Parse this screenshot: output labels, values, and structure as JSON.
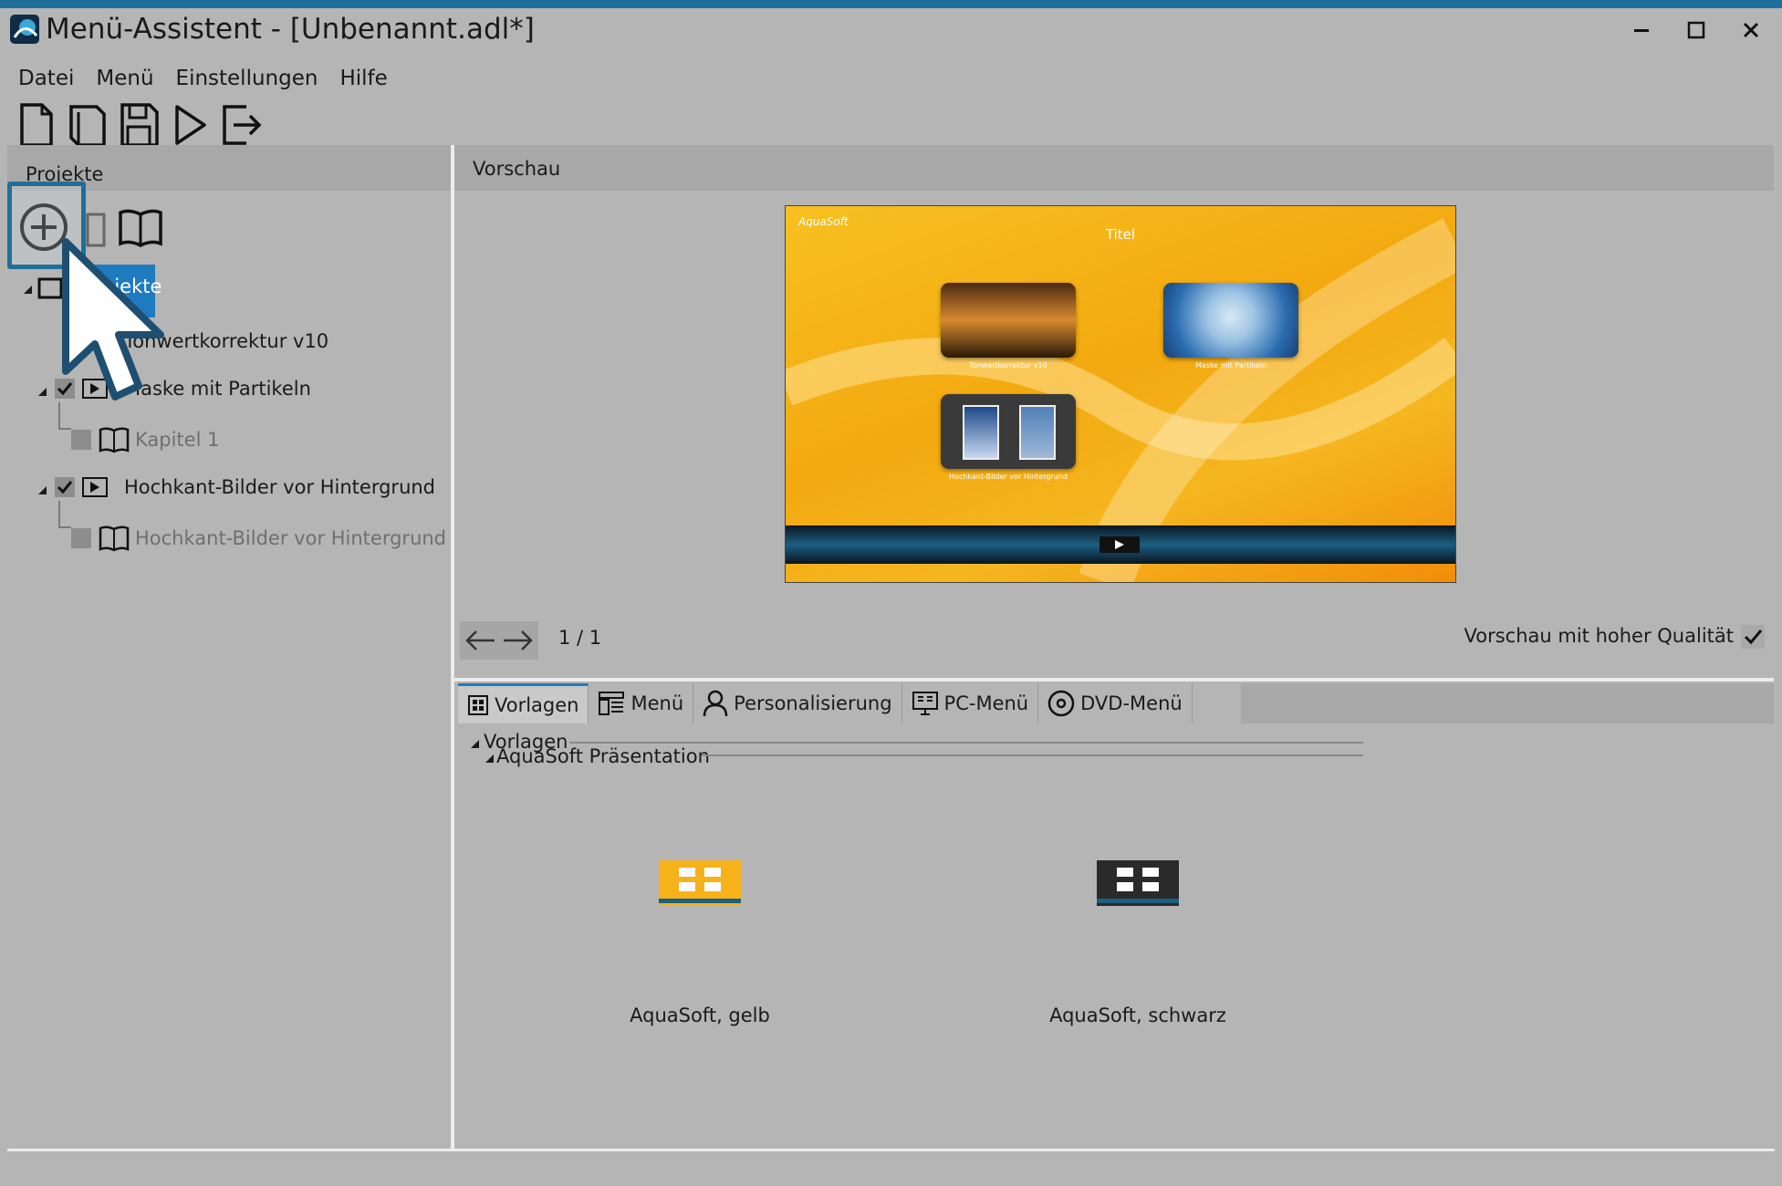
{
  "window": {
    "title": "Menü-Assistent - [Unbenannt.adl*]",
    "controls": {
      "minimize": "—",
      "maximize": "☐",
      "close": "✕"
    }
  },
  "menubar": [
    "Datei",
    "Menü",
    "Einstellungen",
    "Hilfe"
  ],
  "toolbar": [
    "new-file-icon",
    "open-icon",
    "save-icon",
    "play-icon",
    "exit-icon"
  ],
  "left_panel": {
    "header": "Projekte",
    "tools": [
      "add-circle-icon",
      "delete-icon",
      "book-icon"
    ],
    "root_label": "Projekte",
    "tree": [
      {
        "label": "Tonwertkorrektur v10",
        "checked": true,
        "dimmed": false
      },
      {
        "label": "Maske mit Partikeln",
        "checked": true,
        "dimmed": false
      },
      {
        "label": "Kapitel 1",
        "checked": false,
        "dimmed": true
      },
      {
        "label": "Hochkant-Bilder vor Hintergrund",
        "checked": true,
        "dimmed": false
      },
      {
        "label": "Hochkant-Bilder vor Hintergrund",
        "checked": false,
        "dimmed": true
      }
    ]
  },
  "preview": {
    "header": "Vorschau",
    "logo": "AquaSoft",
    "title": "Titel",
    "items": [
      {
        "caption": "Tonwertkorrektur v10"
      },
      {
        "caption": "Maske mit Partikeln"
      },
      {
        "caption": "Hochkant-Bilder vor Hintergrund"
      }
    ],
    "page_indicator": "1 / 1",
    "high_quality_label": "Vorschau mit hoher Qualität",
    "high_quality_checked": true
  },
  "tabs": [
    {
      "label": "Vorlagen",
      "icon": "grid-icon",
      "active": true
    },
    {
      "label": "Menü",
      "icon": "menu-layout-icon",
      "active": false
    },
    {
      "label": "Personalisierung",
      "icon": "person-icon",
      "active": false
    },
    {
      "label": "PC-Menü",
      "icon": "monitor-icon",
      "active": false
    },
    {
      "label": "DVD-Menü",
      "icon": "disc-icon",
      "active": false
    }
  ],
  "templates": {
    "group": "Vorlagen",
    "subgroup": "AquaSoft Präsentation",
    "items": [
      {
        "label": "AquaSoft, gelb",
        "color": "#f5b21a"
      },
      {
        "label": "AquaSoft, schwarz",
        "color": "#2a2a2a"
      }
    ]
  },
  "colors": {
    "accent": "#1f7bc0",
    "highlight_border": "#1f6f99",
    "titlebar_strip": "#1e6f9a"
  }
}
